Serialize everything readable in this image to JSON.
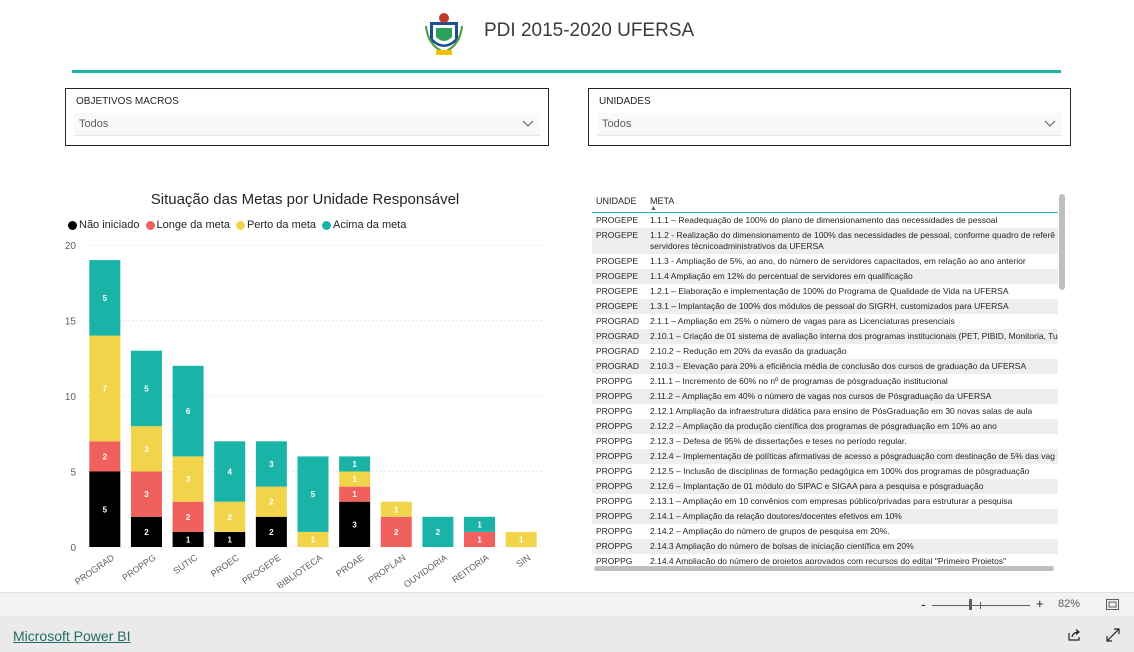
{
  "header": {
    "title": "PDI 2015-2020 UFERSA",
    "accent": "#19b3a7"
  },
  "slicers": [
    {
      "label": "OBJETIVOS MACROS",
      "value": "Todos"
    },
    {
      "label": "UNIDADES",
      "value": "Todos"
    }
  ],
  "chart_data": {
    "type": "bar",
    "stacked": true,
    "title": "Situação das Metas por Unidade Responsável",
    "categories": [
      "PROGRAD",
      "PROPPG",
      "SUTIC",
      "PROEC",
      "PROGEPE",
      "BIBLIOTECA",
      "PROAE",
      "PROPLAN",
      "OUVIDORIA",
      "REITORIA",
      "SIN"
    ],
    "series": [
      {
        "name": "Não iniciado",
        "color": "#000000",
        "values": [
          5,
          2,
          1,
          1,
          2,
          0,
          3,
          0,
          0,
          0,
          0
        ]
      },
      {
        "name": "Longe da meta",
        "color": "#f0605d",
        "values": [
          2,
          3,
          2,
          0,
          0,
          0,
          1,
          2,
          0,
          1,
          0
        ]
      },
      {
        "name": "Perto da meta",
        "color": "#f2d44b",
        "values": [
          7,
          3,
          3,
          2,
          2,
          1,
          1,
          1,
          0,
          0,
          1
        ]
      },
      {
        "name": "Acima da meta",
        "color": "#19b3a7",
        "values": [
          5,
          5,
          6,
          4,
          3,
          5,
          1,
          0,
          2,
          1,
          0
        ]
      }
    ],
    "ylim": [
      0,
      20
    ],
    "yticks": [
      0,
      5,
      10,
      15,
      20
    ],
    "grid": true,
    "legend": "top-left"
  },
  "table": {
    "columns": [
      "UNIDADE",
      "META"
    ],
    "rows": [
      [
        "PROGEPE",
        "1.1.1 – Readequação de 100% do plano de dimensionamento das necessidades de pessoal"
      ],
      [
        "PROGEPE",
        "1.1.2 - Realização do dimensionamento de 100% das necessidades de pessoal, conforme quadro de referê servidores técnicoadministrativos da UFERSA"
      ],
      [
        "PROGEPE",
        "1.1.3 - Ampliação de 5%, ao ano, do número de servidores capacitados, em relação ao ano anterior"
      ],
      [
        "PROGEPE",
        "1.1.4 Ampliação em 12% do percentual de servidores em qualificação"
      ],
      [
        "PROGEPE",
        "1.2.1 – Elaboração e implementação de 100% do Programa de Qualidade de Vida na UFERSA"
      ],
      [
        "PROGEPE",
        "1.3.1 – Implantação de 100% dos módulos de pessoal do SIGRH, customizados para UFERSA"
      ],
      [
        "PROGRAD",
        "2.1.1 – Ampliação em 25% o número de vagas para as Licenciaturas presenciais"
      ],
      [
        "PROGRAD",
        "2.10.1 – Criação de 01 sistema de avaliação interna dos programas institucionais (PET, PIBID, Monitoria, Tu"
      ],
      [
        "PROGRAD",
        "2.10.2 – Redução em 20% da evasão da graduação"
      ],
      [
        "PROGRAD",
        "2.10.3 – Elevação para 20% a eficiência média de conclusão dos cursos de graduação da UFERSA"
      ],
      [
        "PROPPG",
        "2.11.1 – Incremento de 60% no nº de programas de pósgraduação institucional"
      ],
      [
        "PROPPG",
        "2.11.2 – Ampliação em 40% o número de vagas nos cursos de Pósgraduação da UFERSA"
      ],
      [
        "PROPPG",
        "2.12.1 Ampliação da infraestrutura didática para ensino de PósGraduação em 30 novas salas de aula"
      ],
      [
        "PROPPG",
        "2.12.2 – Ampliação da produção científica dos programas de pósgraduação em 10% ao ano"
      ],
      [
        "PROPPG",
        "2.12.3 – Defesa de 95% de dissertações e teses no período regular."
      ],
      [
        "PROPPG",
        "2.12.4 – Implementação de políticas afirmativas de acesso a pósgraduação com destinação de 5% das vag"
      ],
      [
        "PROPPG",
        "2.12.5 – Inclusão de disciplinas de formação pedagógica em 100% dos programas de pósgraduação"
      ],
      [
        "PROPPG",
        "2.12.6 – Implantação de 01 módulo do SIPAC e SIGAA para a pesquisa e pósgraduação"
      ],
      [
        "PROPPG",
        "2.13.1 – Ampliação em 10 convênios com empresas público/privadas para estruturar a pesquisa"
      ],
      [
        "PROPPG",
        "2.14.1 – Ampliação da relação doutores/docentes efetivos em 10%"
      ],
      [
        "PROPPG",
        "2.14.2 – Ampliação do número de grupos de pesquisa em 20%."
      ],
      [
        "PROPPG",
        "2.14.3 Ampliação do número de bolsas de iniciação científica em 20%"
      ],
      [
        "PROPPG",
        "2.14.4 Ampliação do número de projetos aprovados com recursos do edital \"Primeiro Projetos\""
      ]
    ]
  },
  "zoom": {
    "level": "82%",
    "minus": "-",
    "plus": "+"
  },
  "footer": {
    "brand": "Microsoft Power BI"
  }
}
